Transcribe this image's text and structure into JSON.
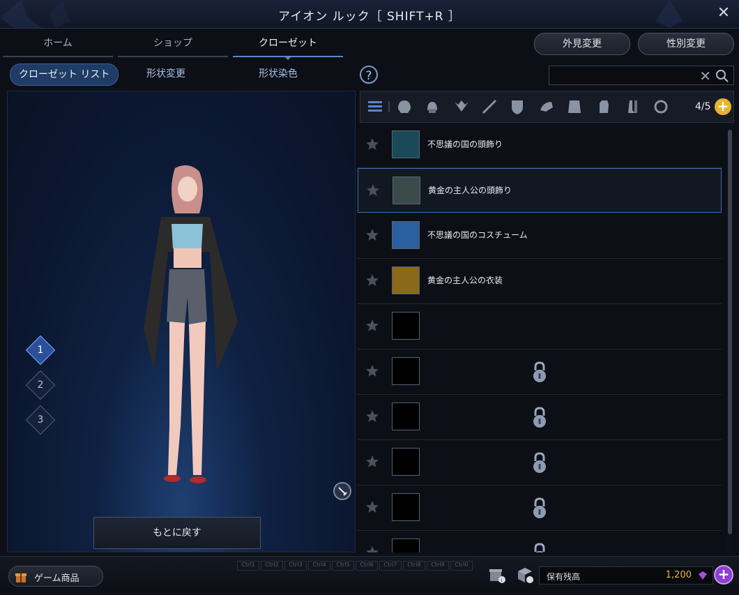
{
  "window": {
    "title": "アイオン ルック［ SHIFT+R ］"
  },
  "tabs": [
    {
      "label": "ホーム"
    },
    {
      "label": "ショップ"
    },
    {
      "label": "クローゼット"
    }
  ],
  "header_buttons": {
    "appearance_change": "外見変更",
    "gender_change": "性別変更"
  },
  "subtabs": [
    {
      "label": "クローゼット リスト"
    },
    {
      "label": "形状変更"
    },
    {
      "label": "形状染色"
    }
  ],
  "help": {
    "label": "?"
  },
  "search": {
    "value": "",
    "placeholder": "",
    "clear": "✕"
  },
  "filter": {
    "count": "4/5",
    "add": "+"
  },
  "presets": [
    "1",
    "2",
    "3"
  ],
  "preview": {
    "revert_label": "もとに戻す"
  },
  "items": [
    {
      "name": "不思議の国の頭飾り",
      "state": "filled",
      "selected": false
    },
    {
      "name": "黄金の主人公の頭飾り",
      "state": "filled",
      "selected": true
    },
    {
      "name": "不思議の国のコスチューム",
      "state": "filled",
      "selected": false
    },
    {
      "name": "黄金の主人公の衣装",
      "state": "filled",
      "selected": false
    },
    {
      "name": "",
      "state": "empty",
      "selected": false
    },
    {
      "name": "",
      "state": "locked",
      "selected": false
    },
    {
      "name": "",
      "state": "locked",
      "selected": false
    },
    {
      "name": "",
      "state": "locked",
      "selected": false
    },
    {
      "name": "",
      "state": "locked",
      "selected": false
    },
    {
      "name": "",
      "state": "locked",
      "selected": false
    }
  ],
  "bottom": {
    "shop_label": "ゲーム商品",
    "balance_label": "保有残高",
    "balance_value": "1,200",
    "topup": "+",
    "hotkeys": [
      "Ctrl1",
      "Ctrl2",
      "Ctrl3",
      "Ctrl4",
      "Ctrl5",
      "Ctrl6",
      "Ctrl7",
      "Ctrl8",
      "Ctrl9",
      "Ctrl0"
    ]
  },
  "colors": {
    "accent": "#5b86c9",
    "selected_border": "#3d6fb0",
    "gold": "#e8b233",
    "purple": "#8d3fd0"
  }
}
